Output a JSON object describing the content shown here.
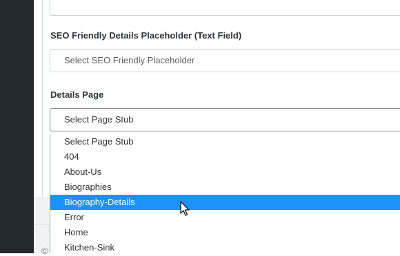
{
  "form": {
    "seo_label": "SEO Friendly Details Placeholder (Text Field)",
    "seo_placeholder": "Select SEO Friendly Placeholder",
    "details_label": "Details Page",
    "details_selected": "Select Page Stub",
    "details_options": [
      "Select Page Stub",
      "404",
      "About-Us",
      "Biographies",
      "Biography-Details",
      "Error",
      "Home",
      "Kitchen-Sink"
    ],
    "highlighted_option": "Biography-Details"
  },
  "footer": {
    "copyright_glyph": "©"
  },
  "colors": {
    "sidebar": "#23292f",
    "highlight": "#1e90ff"
  }
}
